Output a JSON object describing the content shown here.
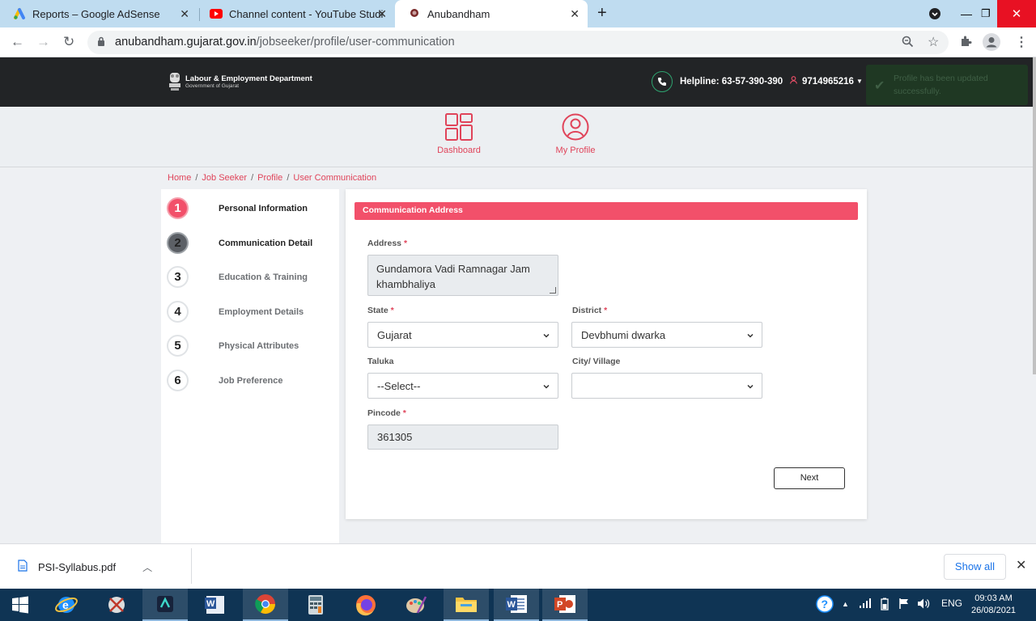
{
  "browser": {
    "tabs": [
      {
        "title": "Reports – Google AdSense",
        "icon": "adsense-icon"
      },
      {
        "title": "Channel content - YouTube Studi",
        "icon": "youtube-icon"
      },
      {
        "title": "Anubandham",
        "icon": "site-emblem-icon",
        "active": true
      }
    ],
    "url_host": "anubandham.gujarat.gov.in",
    "url_path": "/jobseeker/profile/user-communication"
  },
  "header": {
    "dept_title": "Labour & Employment Department",
    "dept_subtitle": "Government of Gujarat",
    "helpline": "Helpline: 63-57-390-390",
    "user_phone": "9714965216"
  },
  "toast": {
    "message": "Profile has been updated successfully."
  },
  "menu": {
    "dashboard": "Dashboard",
    "my_profile": "My Profile"
  },
  "breadcrumb": [
    "Home",
    "Job Seeker",
    "Profile",
    "User Communication"
  ],
  "steps": [
    {
      "num": "1",
      "label": "Personal Information",
      "state": "done"
    },
    {
      "num": "2",
      "label": "Communication Detail",
      "state": "current"
    },
    {
      "num": "3",
      "label": "Education & Training",
      "state": "pending"
    },
    {
      "num": "4",
      "label": "Employment Details",
      "state": "pending"
    },
    {
      "num": "5",
      "label": "Physical Attributes",
      "state": "pending"
    },
    {
      "num": "6",
      "label": "Job Preference",
      "state": "pending"
    }
  ],
  "form": {
    "section_title": "Communication Address",
    "address_label": "Address",
    "address_line1": "Gundamora Vadi Ramnagar Jam",
    "address_line2": "khambhaliya",
    "state_label": "State",
    "state_value": "Gujarat",
    "district_label": "District",
    "district_value": "Devbhumi dwarka",
    "taluka_label": "Taluka",
    "taluka_value": "--Select--",
    "city_label": "City/ Village",
    "city_value": "",
    "pincode_label": "Pincode",
    "pincode_value": "361305",
    "required_mark": "*",
    "next_label": "Next"
  },
  "downloads": {
    "file": "PSI-Syllabus.pdf",
    "show_all": "Show all"
  },
  "taskbar": {
    "time": "09:03 AM",
    "date": "26/08/2021",
    "lang": "ENG"
  }
}
